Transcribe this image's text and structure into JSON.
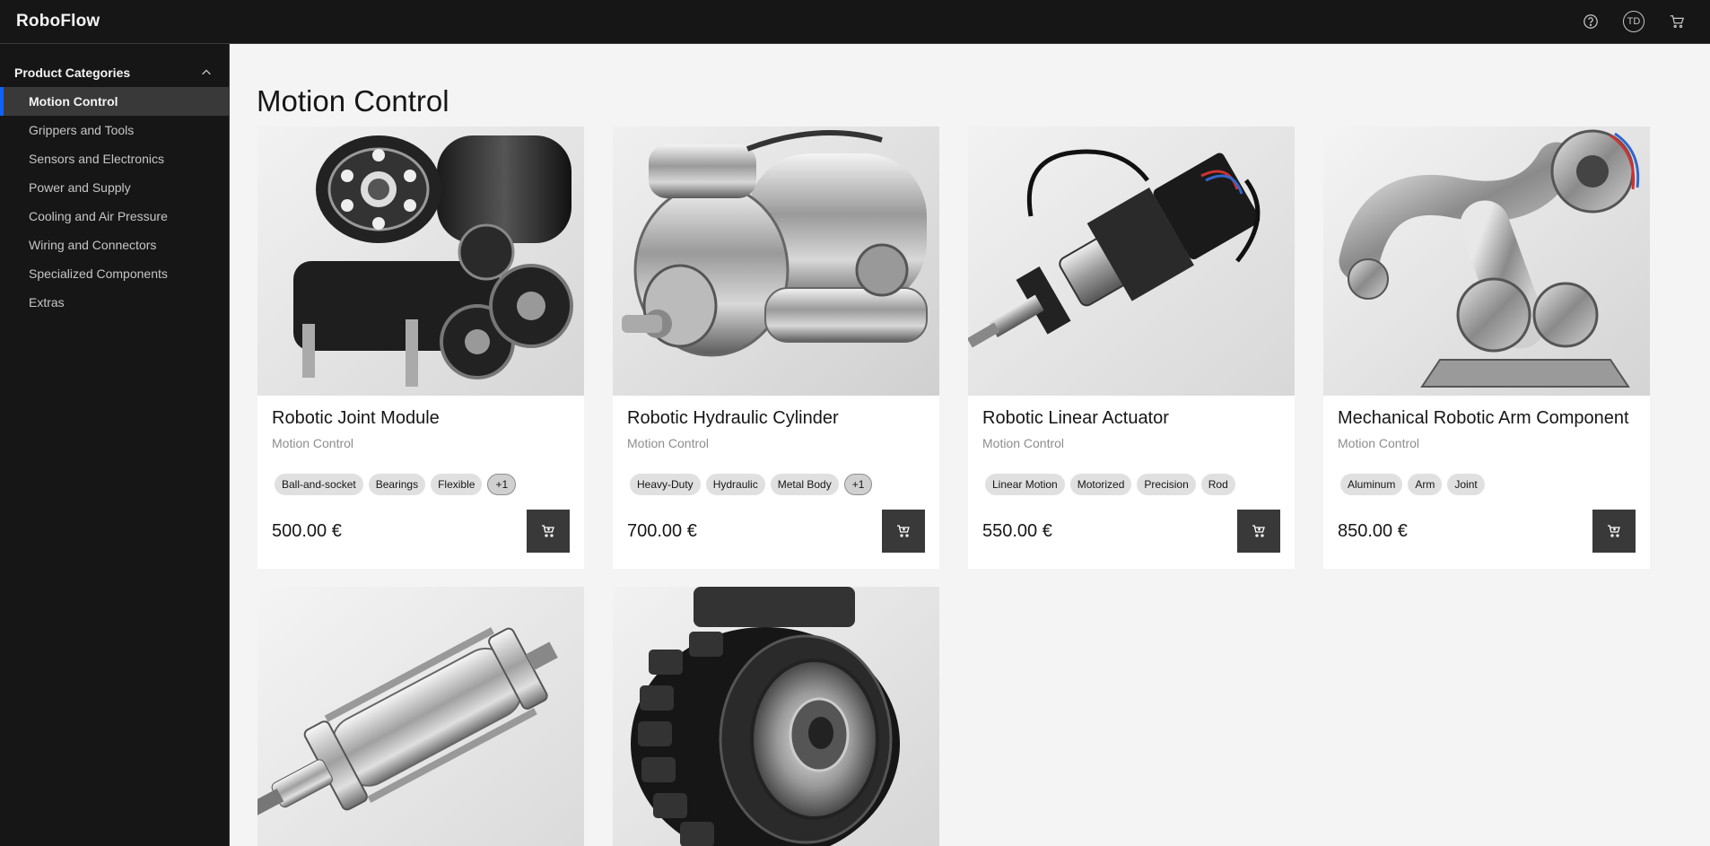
{
  "app": {
    "brand": "RoboFlow",
    "avatar_initials": "TD"
  },
  "header": {
    "icons": [
      "help-icon",
      "user-avatar",
      "cart-icon"
    ]
  },
  "sidebar": {
    "heading": "Product Categories",
    "items": [
      {
        "label": "Motion Control",
        "active": true
      },
      {
        "label": "Grippers and Tools",
        "active": false
      },
      {
        "label": "Sensors and Electronics",
        "active": false
      },
      {
        "label": "Power and Supply",
        "active": false
      },
      {
        "label": "Cooling and Air Pressure",
        "active": false
      },
      {
        "label": "Wiring and Connectors",
        "active": false
      },
      {
        "label": "Specialized Components",
        "active": false
      },
      {
        "label": "Extras",
        "active": false
      }
    ]
  },
  "main": {
    "title": "Motion Control",
    "products": [
      {
        "name": "Robotic Joint Module",
        "category": "Motion Control",
        "tags": [
          "Ball-and-socket",
          "Bearings",
          "Flexible"
        ],
        "more_tags": "+1",
        "price": "500.00 €"
      },
      {
        "name": "Robotic Hydraulic Cylinder",
        "category": "Motion Control",
        "tags": [
          "Heavy-Duty",
          "Hydraulic",
          "Metal Body"
        ],
        "more_tags": "+1",
        "price": "700.00 €"
      },
      {
        "name": "Robotic Linear Actuator",
        "category": "Motion Control",
        "tags": [
          "Linear Motion",
          "Motorized",
          "Precision",
          "Rod"
        ],
        "more_tags": "",
        "price": "550.00 €"
      },
      {
        "name": "Mechanical Robotic Arm Component",
        "category": "Motion Control",
        "tags": [
          "Aluminum",
          "Arm",
          "Joint"
        ],
        "more_tags": "",
        "price": "850.00 €"
      },
      {
        "name": "",
        "category": "",
        "tags": [],
        "more_tags": "",
        "price": ""
      },
      {
        "name": "",
        "category": "",
        "tags": [],
        "more_tags": "",
        "price": ""
      }
    ]
  },
  "colors": {
    "header_bg": "#161616",
    "page_bg": "#f4f4f4",
    "accent": "#0f62fe",
    "button_bg": "#393939"
  }
}
